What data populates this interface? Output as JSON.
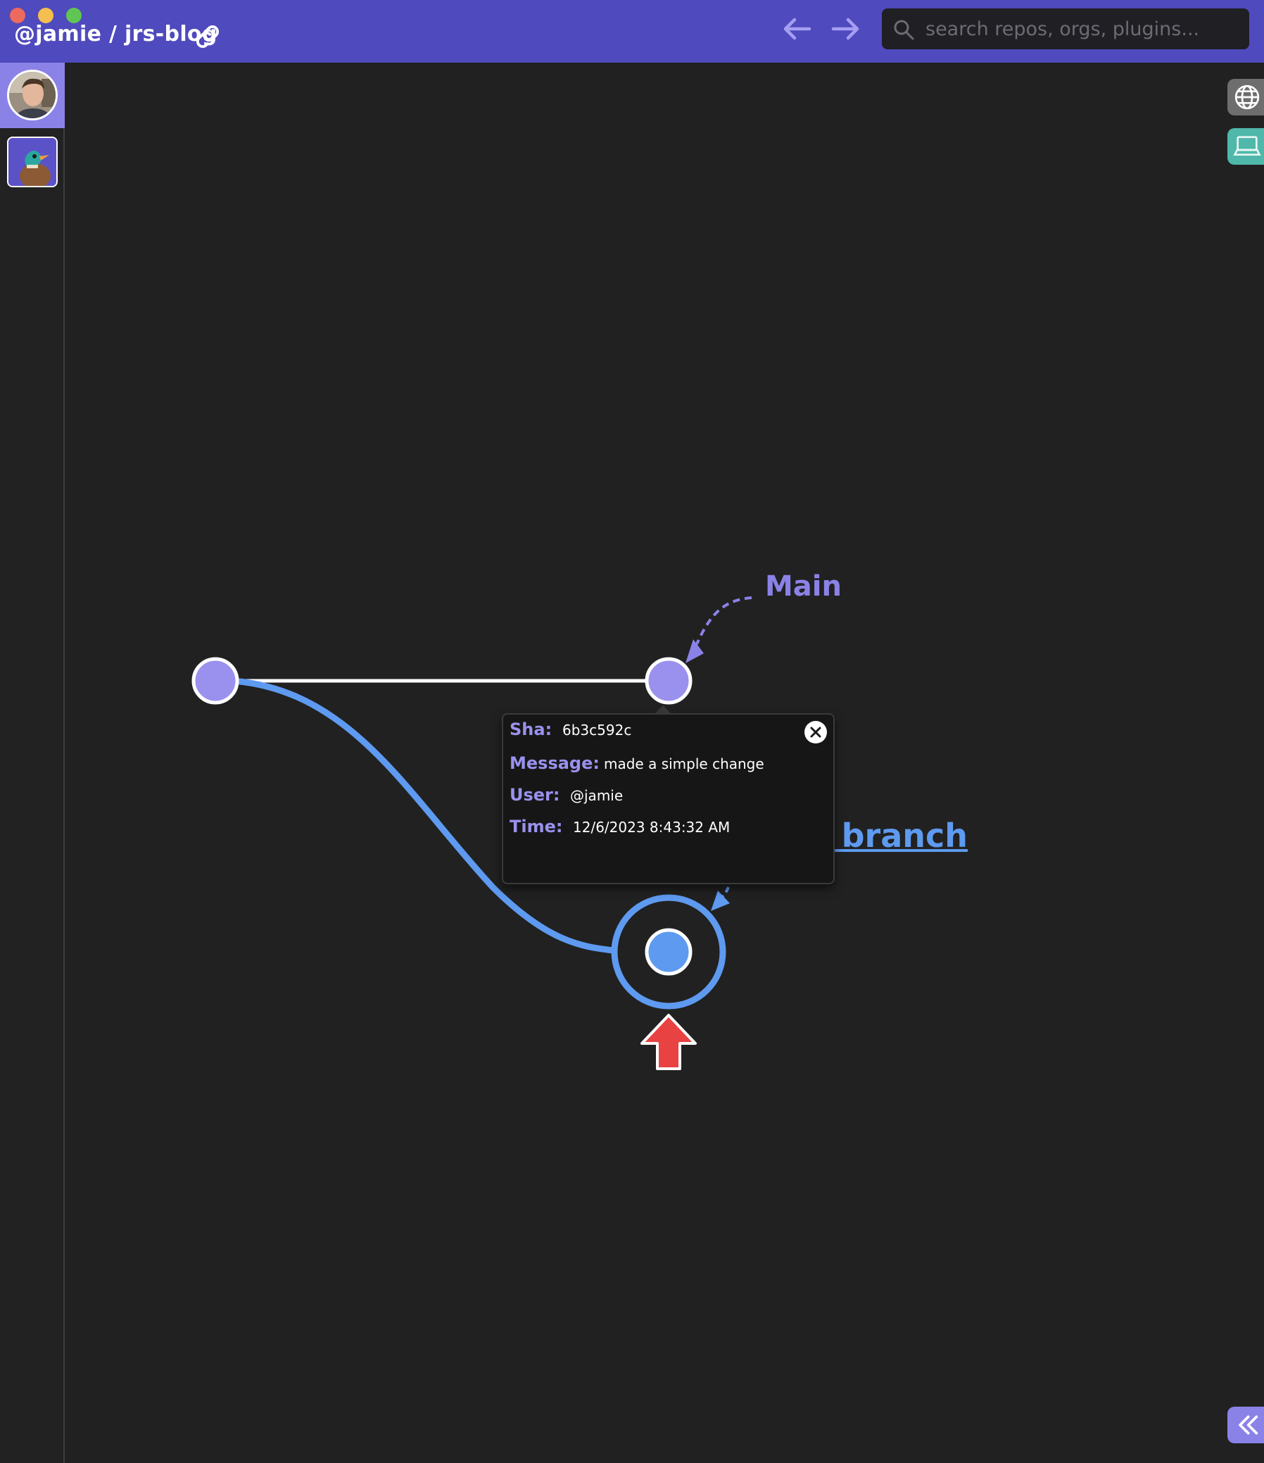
{
  "window": {
    "breadcrumb": "@jamie / jrs-blog",
    "traffic_lights": [
      "close",
      "minimize",
      "zoom"
    ]
  },
  "toolbar": {
    "back_icon": "arrow-left-icon",
    "forward_icon": "arrow-right-icon",
    "search_placeholder": "search repos, orgs, plugins..."
  },
  "sidebar": {
    "items": [
      {
        "name": "user-avatar",
        "active": true
      },
      {
        "name": "duck-org-icon",
        "active": false
      }
    ]
  },
  "graph": {
    "branches": {
      "main": "Main",
      "current": "Current branch",
      "current_visible": "t branch"
    },
    "commits": [
      {
        "branch": "main",
        "role": "root"
      },
      {
        "branch": "main",
        "role": "head"
      },
      {
        "branch": "current",
        "role": "head",
        "selected": true
      }
    ]
  },
  "popup": {
    "sha_label": "Sha:",
    "sha_value": "6b3c592c",
    "message_label": "Message:",
    "message_value": "made a simple change",
    "user_label": "User:",
    "user_value": "@jamie",
    "time_label": "Time:",
    "time_value": "12/6/2023 8:43:32 AM"
  },
  "edge_tabs": [
    "globe-icon",
    "laptop-icon",
    "double-chevron-left-icon"
  ],
  "colors": {
    "titlebar": "#4f4abd",
    "accent_purple": "#8b82e8",
    "branch_blue": "#5e9af0",
    "background": "#212121",
    "arrow_red": "#e84242"
  }
}
